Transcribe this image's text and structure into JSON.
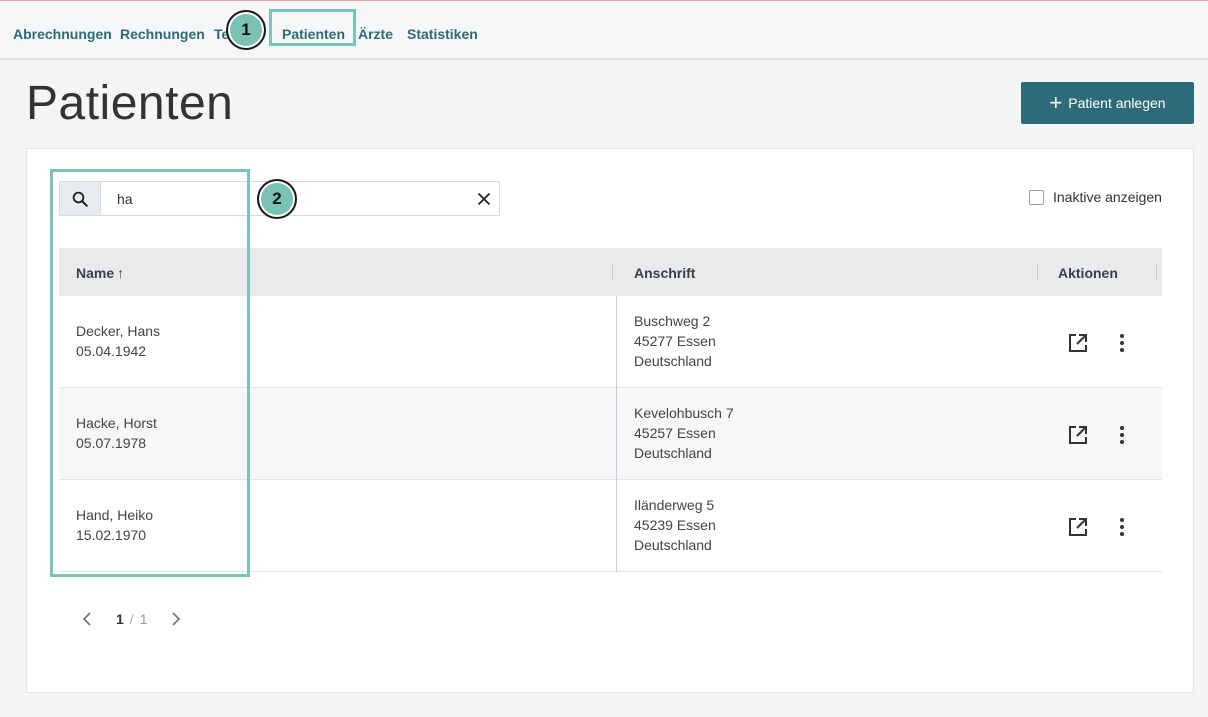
{
  "nav": {
    "items": [
      {
        "label": "Abrechnungen",
        "active": false
      },
      {
        "label": "Rechnungen",
        "active": false
      },
      {
        "label": "Te",
        "active": false
      },
      {
        "label": "Patienten",
        "active": true
      },
      {
        "label": "Ärzte",
        "active": false
      },
      {
        "label": "Statistiken",
        "active": false
      }
    ]
  },
  "page": {
    "title": "Patienten",
    "add_button_label": "Patient anlegen"
  },
  "search": {
    "value": "ha",
    "icon": "search-icon",
    "clear_icon": "close-icon"
  },
  "filter": {
    "inactive_label": "Inaktive anzeigen",
    "checked": false
  },
  "table": {
    "columns": [
      "Name",
      "Anschrift",
      "Aktionen"
    ],
    "sort_indicator": "↑",
    "rows": [
      {
        "name": "Decker, Hans",
        "dob": "05.04.1942",
        "street": "Buschweg 2",
        "city": "45277 Essen",
        "country": "Deutschland"
      },
      {
        "name": "Hacke, Horst",
        "dob": "05.07.1978",
        "street": "Kevelohbusch 7",
        "city": "45257 Essen",
        "country": "Deutschland"
      },
      {
        "name": "Hand, Heiko",
        "dob": "15.02.1970",
        "street": "Iländerweg 5",
        "city": "45239 Essen",
        "country": "Deutschland"
      }
    ]
  },
  "pagination": {
    "current": "1",
    "separator": "/",
    "total": "1"
  },
  "annotations": {
    "badge1": "1",
    "badge2": "2",
    "color": "#79c2b5"
  },
  "colors": {
    "accent": "#2e6b78",
    "highlight": "#7cc4b8"
  }
}
